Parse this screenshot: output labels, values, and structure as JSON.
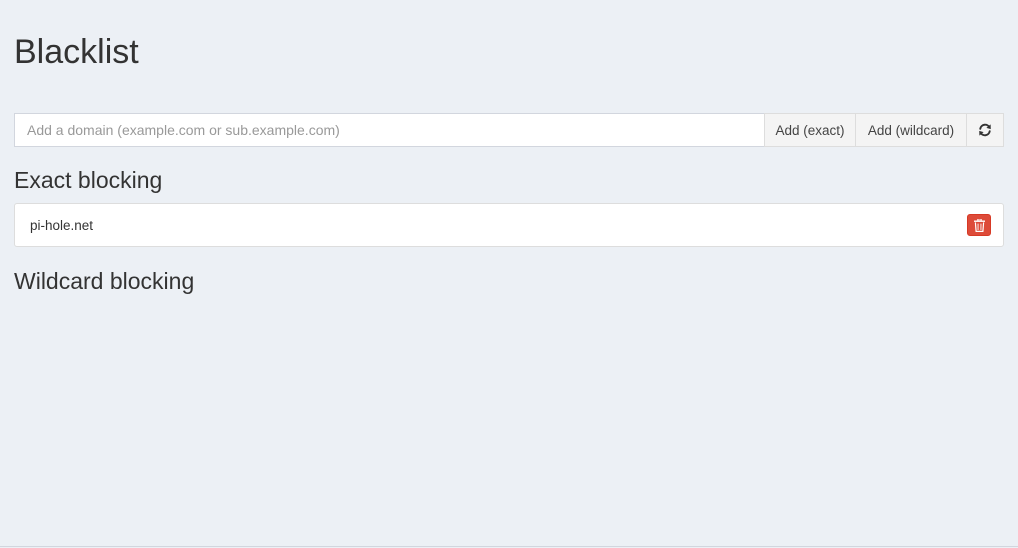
{
  "page": {
    "title": "Blacklist"
  },
  "add_form": {
    "input_placeholder": "Add a domain (example.com or sub.example.com)",
    "input_value": "",
    "add_exact_label": "Add (exact)",
    "add_wildcard_label": "Add (wildcard)",
    "refresh_icon": "refresh-icon"
  },
  "sections": {
    "exact": {
      "heading": "Exact blocking",
      "items": [
        {
          "domain": "pi-hole.net",
          "delete_icon": "trash-icon"
        }
      ]
    },
    "wildcard": {
      "heading": "Wildcard blocking",
      "items": []
    }
  },
  "colors": {
    "background": "#ecf0f5",
    "delete_button": "#dd4b39",
    "button_bg": "#f4f4f4",
    "text": "#333333"
  }
}
